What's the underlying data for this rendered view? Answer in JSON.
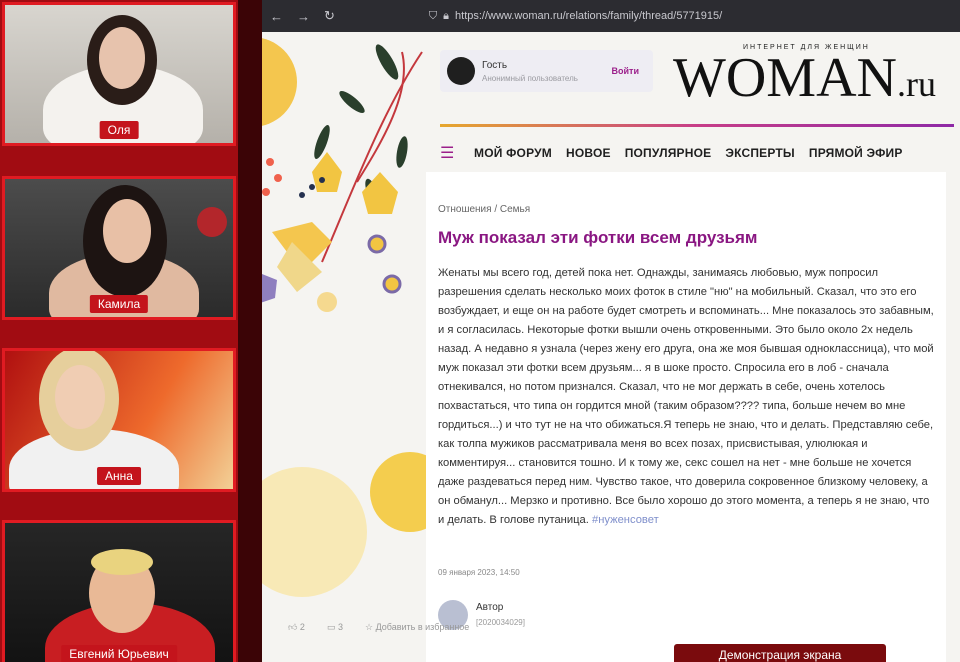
{
  "participants": [
    {
      "name": "Оля"
    },
    {
      "name": "Камила"
    },
    {
      "name": "Анна"
    },
    {
      "name": "Евгений Юрьевич"
    }
  ],
  "browser": {
    "url": "https://www.woman.ru/relations/family/thread/5771915/"
  },
  "header": {
    "user": {
      "title": "Гость",
      "subtitle": "Анонимный пользователь",
      "login_label": "Войти"
    },
    "logo_tagline": "ИНТЕРНЕТ ДЛЯ ЖЕНЩИН",
    "logo_main": "WOMAN",
    "logo_suffix": ".ru"
  },
  "nav": {
    "items": [
      "МОЙ ФОРУМ",
      "НОВОЕ",
      "ПОПУЛЯРНОЕ",
      "ЭКСПЕРТЫ",
      "ПРЯМОЙ ЭФИР"
    ]
  },
  "post": {
    "breadcrumb": "Отношения / Семья",
    "title": "Муж показал эти фотки всем друзьям",
    "body": "Женаты мы всего год, детей пока нет. Однажды, занимаясь любовью, муж попросил разрешения сделать несколько моих фоток в стиле \"ню\" на мобильный. Сказал, что это его возбуждает, и еще он на работе будет смотреть и вспоминать... Мне показалось это забавным, и я согласилась. Некоторые фотки вышли очень откровенными. Это было около 2х недель назад. А недавно я узнала (через жену его друга, она же моя бывшая одноклассница), что мой муж показал эти фотки всем друзьям... я в шоке просто. Спросила его в лоб - сначала отнекивался, но потом признался. Сказал, что не мог держать в себе, очень хотелось похвастаться, что типа он гордится мной (таким образом???? типа, больше нечем во мне гордиться...) и что тут не на что обижаться.Я теперь не знаю, что и делать. Представляю себе, как толпа мужиков рассматривала меня во всех позах, присвистывая, улюлюкая и комментируя... становится тошно. И к тому же, секс сошел на нет - мне больше не хочется даже раздеваться перед ним. Чувство такое, что доверила сокровенное близкому человеку, а он обманул... Мерзко и противно. Все было хорошо до этого момента, а теперь я не знаю, что и делать. В голове путаница.",
    "hashtag": "#нуженсовет",
    "date": "09 января 2023, 14:50",
    "author_label": "Автор",
    "author_id": "[2020034029]",
    "likes": "2",
    "comments": "3",
    "add_fav": "Добавить в избранное"
  },
  "screen_share_label": "Демонстрация экрана"
}
